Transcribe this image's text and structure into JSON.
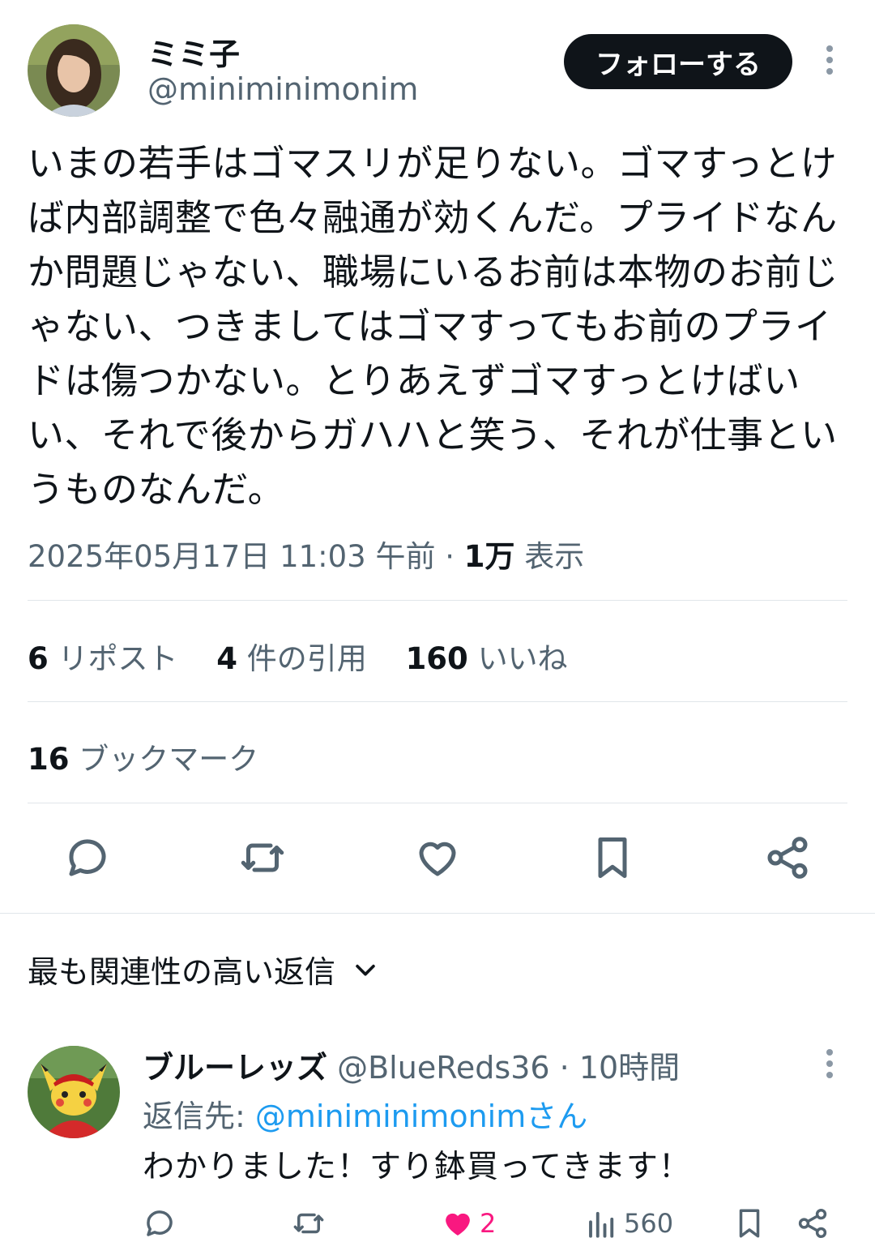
{
  "tweet": {
    "author": {
      "display_name": "ミミ子",
      "handle": "@miniminimonim"
    },
    "follow_label": "フォローする",
    "text": "いまの若手はゴマスリが足りない。ゴマすっとけば内部調整で色々融通が効くんだ。プライドなんか問題じゃない、職場にいるお前は本物のお前じゃない、つきましてはゴマすってもお前のプライドは傷つかない。とりあえずゴマすっとけばいい、それで後からガハハと笑う、それが仕事というものなんだ。",
    "timestamp": "2025年05月17日 11:03 午前",
    "separator": "·",
    "views_count": "1万",
    "views_label": "表示",
    "stats": {
      "reposts_count": "6",
      "reposts_label": "リポスト",
      "quotes_count": "4",
      "quotes_label": "件の引用",
      "likes_count": "160",
      "likes_label": "いいね",
      "bookmarks_count": "16",
      "bookmarks_label": "ブックマーク"
    },
    "actions": [
      "reply-icon",
      "repost-icon",
      "like-icon",
      "bookmark-icon",
      "share-icon"
    ]
  },
  "replies_sort_label": "最も関連性の高い返信",
  "reply": {
    "display_name": "ブルーレッズ",
    "handle": "@BlueReds36",
    "separator": "·",
    "time": "10時間",
    "reply_to_prefix": "返信先: ",
    "reply_to_mention": "@miniminimonimさん",
    "text": "わかりました！すり鉢買ってきます！",
    "likes": "2",
    "views": "560"
  },
  "colors": {
    "text": "#0f1419",
    "secondary": "#536471",
    "link": "#1d9bf0",
    "like": "#f91880",
    "button_bg": "#0f1419"
  }
}
